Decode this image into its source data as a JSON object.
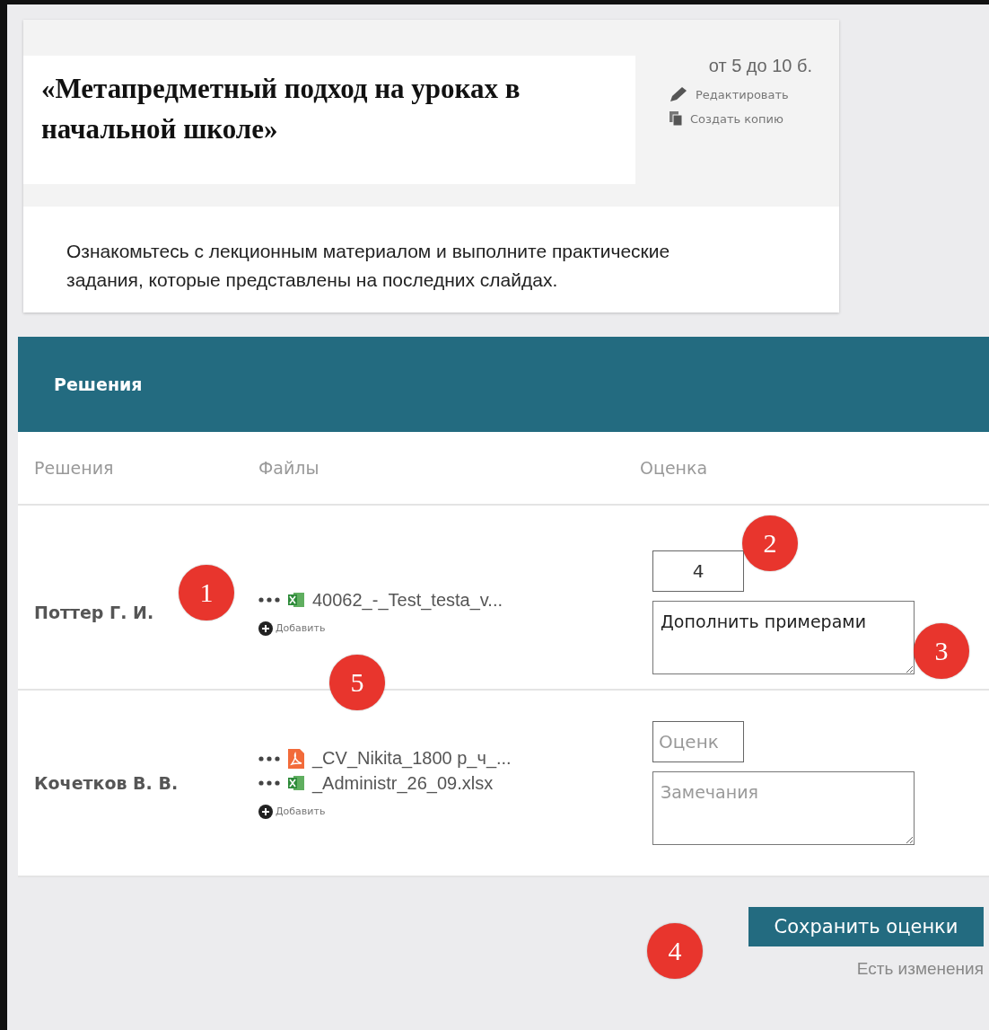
{
  "task": {
    "title": "«Метапредметный подход на уроках в начальной школе»",
    "points": "от 5 до 10 б.",
    "actions": [
      {
        "kind": "edit",
        "label": "Редактировать"
      },
      {
        "kind": "copy",
        "label": "Создать копию"
      }
    ],
    "description": "Ознакомьтесь с лекционным материалом и выполните практические задания, которые представлены на последних слайдах."
  },
  "solutions": {
    "title": "Решения",
    "columns": [
      "Решения",
      "Файлы",
      "Оценка"
    ],
    "rows": [
      {
        "student": "Поттер Г. И.",
        "files": [
          {
            "kind": "xlsx",
            "name": "40062_-_Test_testa_v..."
          }
        ],
        "add_label": "Добавить",
        "score": {
          "value": "4"
        },
        "comment": {
          "value": "Дополнить примерами"
        }
      },
      {
        "student": "Кочетков В. В.",
        "files": [
          {
            "kind": "pdf",
            "name": "_CV_Nikita_1800 р_ч_..."
          },
          {
            "kind": "xlsx",
            "name": "_Administr_26_09.xlsx"
          }
        ],
        "add_label": "Добавить",
        "score": {
          "placeholder": "Оценк"
        },
        "comment": {
          "placeholder": "Замечания"
        }
      }
    ]
  },
  "save_button": "Сохранить оценки",
  "status": "Есть изменения",
  "annotations": [
    "1",
    "2",
    "3",
    "4",
    "5"
  ]
}
